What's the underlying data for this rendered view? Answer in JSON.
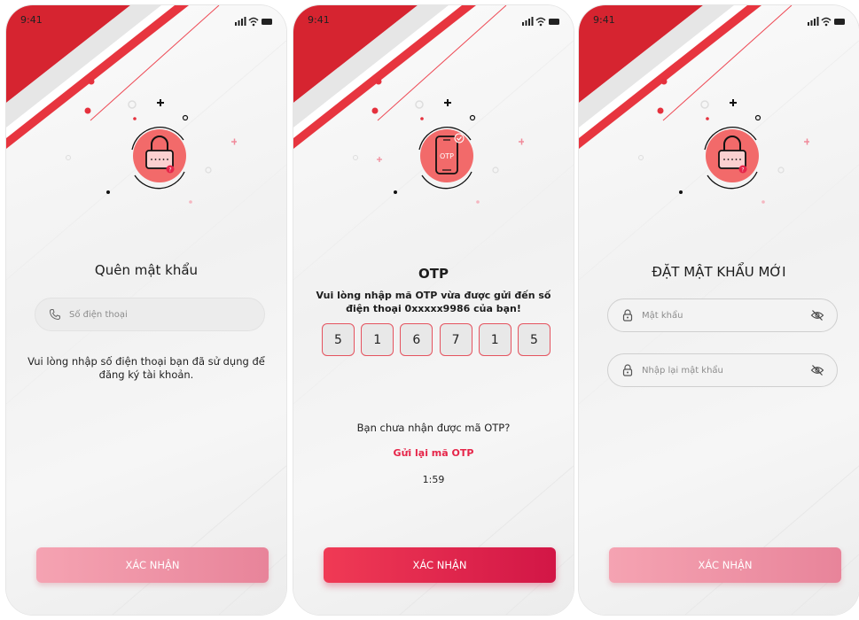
{
  "status_bar": {
    "time": "9:41"
  },
  "screens": [
    {
      "title": "Quên mật khẩu",
      "phone_field": {
        "placeholder": "Số điện thoại",
        "icon": "phone-icon"
      },
      "hint": "Vui lòng nhập số điện thoại bạn đã sử dụng để đăng ký tài khoản.",
      "button_label": "XÁC NHẬN"
    },
    {
      "title": "OTP",
      "message": "Vui lòng nhập mã OTP vừa được gửi đến số điện thoại 0xxxxx9986 của bạn!",
      "otp_digits": [
        "5",
        "1",
        "6",
        "7",
        "1",
        "5"
      ],
      "illustration_label": "OTP",
      "resend_question": "Bạn chưa nhận được mã OTP?",
      "resend_link": "Gửi lại mã OTP",
      "countdown": "1:59",
      "button_label": "XÁC NHẬN"
    },
    {
      "title": "ĐẶT MẬT KHẨU MỚI",
      "password_field": {
        "placeholder": "Mật khẩu",
        "icon": "lock-icon",
        "toggle_icon": "eye-off-icon"
      },
      "confirm_field": {
        "placeholder": "Nhập lại mật khẩu",
        "icon": "lock-icon",
        "toggle_icon": "eye-off-icon"
      },
      "button_label": "XÁC NHẬN"
    }
  ],
  "colors": {
    "accent": "#e62549",
    "stripe_red": "#d9202e",
    "illustration_fill": "#f06a6a",
    "button_disabled": "#f0a0b0",
    "button_active": "#e0244a"
  }
}
